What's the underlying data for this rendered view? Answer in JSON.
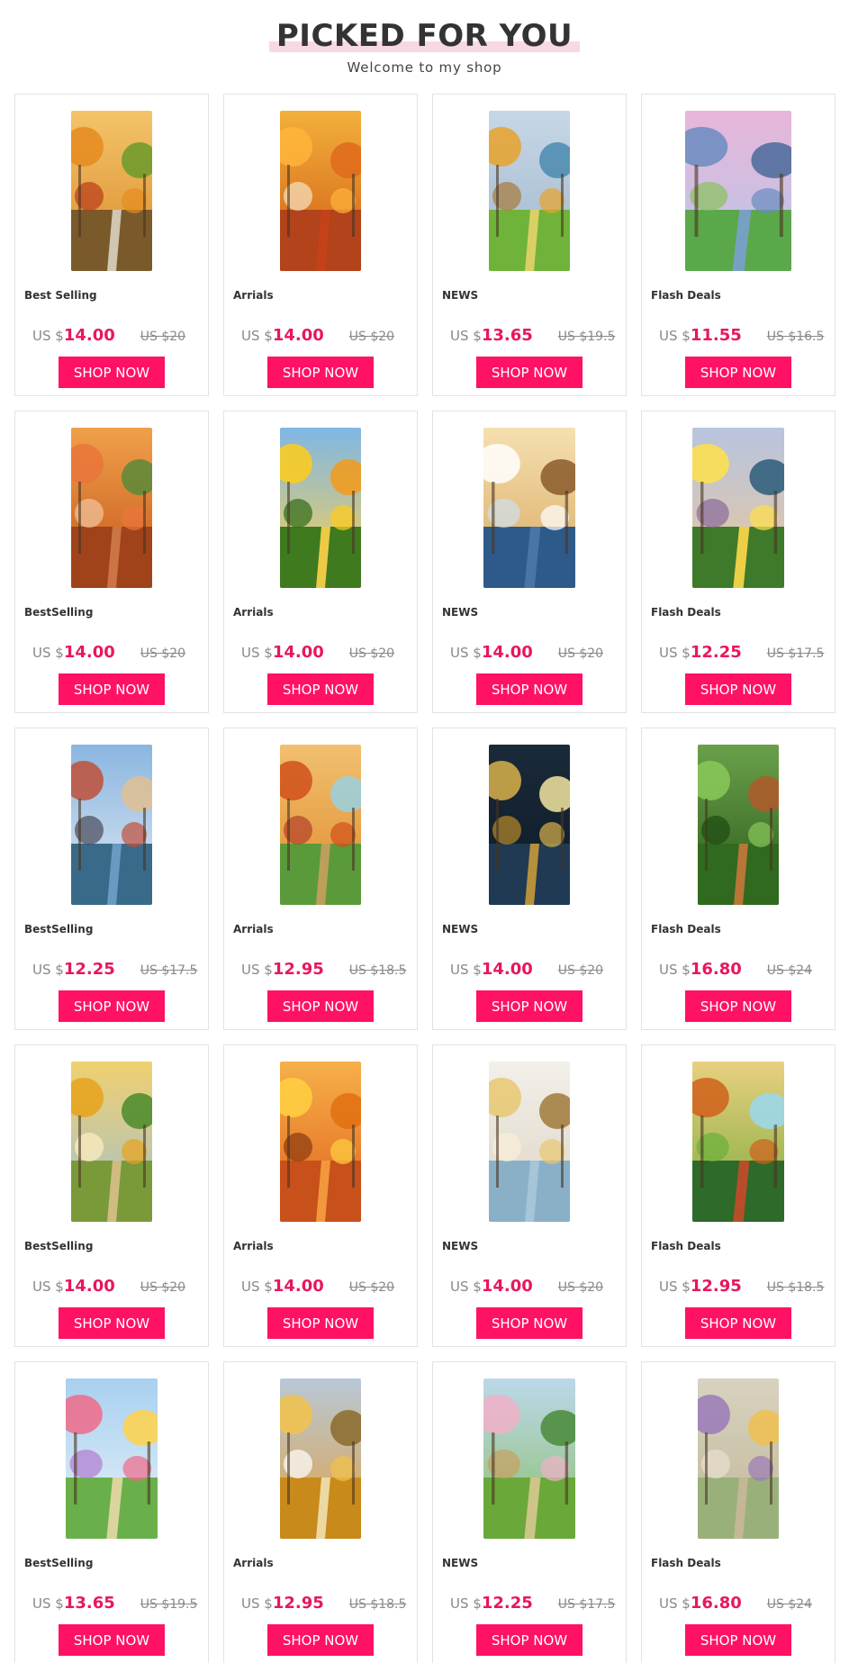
{
  "header": {
    "title": "PICKED FOR YOU",
    "subtitle": "Welcome to my shop",
    "accent_color": "#f8d9e3"
  },
  "colors": {
    "price": "#e8175d",
    "button": "#ff1166"
  },
  "products": [
    {
      "label": "Best Selling",
      "currency": "US $",
      "price": "14.00",
      "old_price": "US $20",
      "button": "SHOP NOW",
      "image": "autumn-path-painting"
    },
    {
      "label": "Arrials",
      "currency": "US $",
      "price": "14.00",
      "old_price": "US $20",
      "button": "SHOP NOW",
      "image": "orange-birch-forest-painting"
    },
    {
      "label": "NEWS",
      "currency": "US $",
      "price": "13.65",
      "old_price": "US $19.5",
      "button": "SHOP NOW",
      "image": "mountain-lake-painting"
    },
    {
      "label": "Flash Deals",
      "currency": "US $",
      "price": "11.55",
      "old_price": "US $16.5",
      "button": "SHOP NOW",
      "image": "blue-mountains-painting"
    },
    {
      "label": "BestSelling",
      "currency": "US $",
      "price": "14.00",
      "old_price": "US $20",
      "button": "SHOP NOW",
      "image": "red-forest-path-painting"
    },
    {
      "label": "Arrials",
      "currency": "US $",
      "price": "14.00",
      "old_price": "US $20",
      "button": "SHOP NOW",
      "image": "sunflower-sunset-painting"
    },
    {
      "label": "NEWS",
      "currency": "US $",
      "price": "14.00",
      "old_price": "US $20",
      "button": "SHOP NOW",
      "image": "sailing-ship-waves-painting"
    },
    {
      "label": "Flash Deals",
      "currency": "US $",
      "price": "12.25",
      "old_price": "US $17.5",
      "button": "SHOP NOW",
      "image": "yellow-flowers-lake-painting"
    },
    {
      "label": "BestSelling",
      "currency": "US $",
      "price": "12.25",
      "old_price": "US $17.5",
      "button": "SHOP NOW",
      "image": "venice-canal-painting"
    },
    {
      "label": "Arrials",
      "currency": "US $",
      "price": "12.95",
      "old_price": "US $18.5",
      "button": "SHOP NOW",
      "image": "autumn-waterfall-painting"
    },
    {
      "label": "NEWS",
      "currency": "US $",
      "price": "14.00",
      "old_price": "US $20",
      "button": "SHOP NOW",
      "image": "golden-deer-moon-painting"
    },
    {
      "label": "Flash Deals",
      "currency": "US $",
      "price": "16.80",
      "old_price": "US $24",
      "button": "SHOP NOW",
      "image": "bamboo-forest-path-painting"
    },
    {
      "label": "BestSelling",
      "currency": "US $",
      "price": "14.00",
      "old_price": "US $20",
      "button": "SHOP NOW",
      "image": "golden-trees-waterfall-painting"
    },
    {
      "label": "Arrials",
      "currency": "US $",
      "price": "14.00",
      "old_price": "US $20",
      "button": "SHOP NOW",
      "image": "fiery-autumn-path-painting"
    },
    {
      "label": "NEWS",
      "currency": "US $",
      "price": "14.00",
      "old_price": "US $20",
      "button": "SHOP NOW",
      "image": "golden-ship-sea-painting"
    },
    {
      "label": "Flash Deals",
      "currency": "US $",
      "price": "12.95",
      "old_price": "US $18.5",
      "button": "SHOP NOW",
      "image": "garden-waterfall-painting"
    },
    {
      "label": "BestSelling",
      "currency": "US $",
      "price": "13.65",
      "old_price": "US $19.5",
      "button": "SHOP NOW",
      "image": "flower-garden-sea-painting"
    },
    {
      "label": "Arrials",
      "currency": "US $",
      "price": "12.95",
      "old_price": "US $18.5",
      "button": "SHOP NOW",
      "image": "golden-valley-waterfall-painting"
    },
    {
      "label": "NEWS",
      "currency": "US $",
      "price": "12.25",
      "old_price": "US $17.5",
      "button": "SHOP NOW",
      "image": "spring-village-path-painting"
    },
    {
      "label": "Flash Deals",
      "currency": "US $",
      "price": "16.80",
      "old_price": "US $24",
      "button": "SHOP NOW",
      "image": "arched-garden-painting"
    }
  ]
}
